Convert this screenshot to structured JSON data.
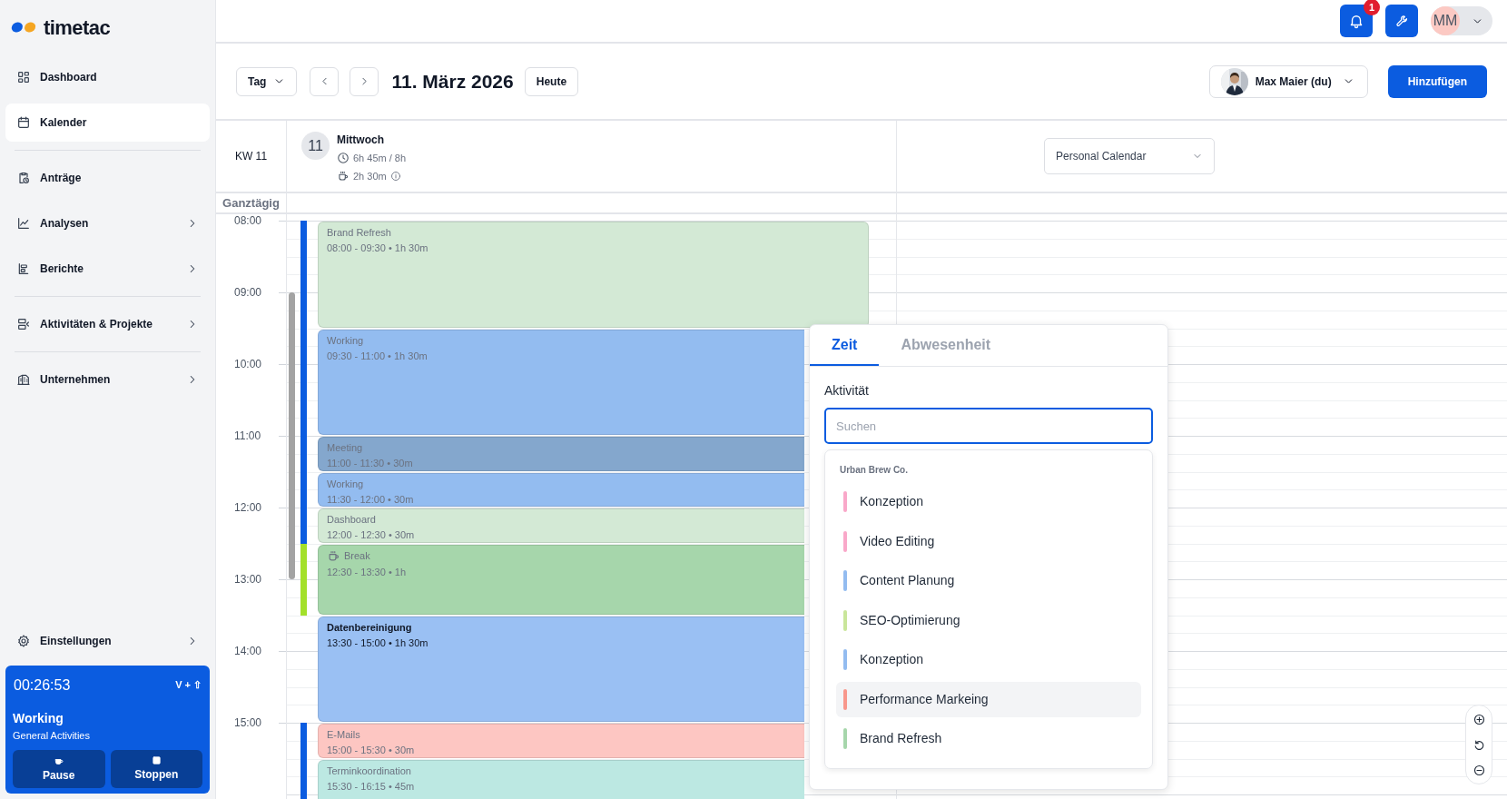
{
  "sidebar": {
    "logo": "timetac",
    "sections": [
      [
        {
          "label": "Dashboard",
          "selected": false,
          "submenu": false
        },
        {
          "label": "Kalender",
          "selected": true,
          "submenu": false
        }
      ],
      [
        {
          "label": "Anträge",
          "selected": false,
          "submenu": false
        },
        {
          "label": "Analysen",
          "selected": false,
          "submenu": true
        },
        {
          "label": "Berichte",
          "selected": false,
          "submenu": true
        }
      ],
      [
        {
          "label": "Aktivitäten & Projekte",
          "selected": false,
          "submenu": true
        }
      ],
      [
        {
          "label": "Unternehmen",
          "selected": false,
          "submenu": true
        }
      ]
    ],
    "footer_item": {
      "label": "Einstellungen",
      "submenu": true
    },
    "timer": {
      "time": "00:26:53",
      "shortcut": "V + ⇧",
      "activity": "Working",
      "category": "General Activities",
      "buttons": [
        "Pause",
        "Stoppen"
      ]
    }
  },
  "topbar": {
    "notifications": "1",
    "user_initials": "MM"
  },
  "toolbar": {
    "view": "Tag",
    "date": "11. März 2026",
    "today": "Heute",
    "user": "Max Maier (du)",
    "add": "Hinzufügen"
  },
  "day_header": {
    "week": "KW 11",
    "day_number": "11",
    "weekday": "Mittwoch",
    "worked": "6h 45m / 8h",
    "break": "2h 30m",
    "calendar": "Personal Calendar"
  },
  "all_day_label": "Ganztägig",
  "hours": [
    "08:00",
    "09:00",
    "10:00",
    "11:00",
    "12:00",
    "13:00",
    "14:00",
    "15:00"
  ],
  "events": [
    {
      "title": "Brand Refresh",
      "time": "08:00 - 09:30 • 1h 30m",
      "color": "#d3e9d5",
      "kind": "work",
      "tracking": {
        "color": "#0b5ce0"
      },
      "selected": false
    },
    {
      "title": "Working",
      "time": "09:30 - 11:00 • 1h 30m",
      "color": "#93bcf0",
      "kind": "work",
      "tracking": {
        "color": "#0b5ce0"
      },
      "selected": false
    },
    {
      "title": "Meeting",
      "time": "11:00 - 11:30 • 30m",
      "color": "#84a7cd",
      "kind": "work",
      "tracking": {
        "color": "#0b5ce0"
      },
      "selected": false
    },
    {
      "title": "Working",
      "time": "11:30 - 12:00 • 30m",
      "color": "#93bcf0",
      "kind": "work",
      "tracking": {
        "color": "#0b5ce0"
      },
      "selected": false
    },
    {
      "title": "Dashboard",
      "time": "12:00 - 12:30 • 30m",
      "color": "#d3e9d5",
      "kind": "work",
      "tracking": {
        "color": "#0b5ce0"
      },
      "selected": false
    },
    {
      "title": "Break",
      "time": "12:30 - 13:30 • 1h",
      "color": "#a6d6ab",
      "kind": "break",
      "tracking": {
        "color": "#a3e02a"
      },
      "selected": false
    },
    {
      "title": "Datenbereinigung",
      "time": "13:30 - 15:00 • 1h 30m",
      "color": "#9ac0f3",
      "kind": "work",
      "selected": true
    },
    {
      "title": "E-Mails",
      "time": "15:00 - 15:30 • 30m",
      "color": "#fdc6c2",
      "kind": "work",
      "tracking": {
        "color": "#0b5ce0"
      },
      "selected": false
    },
    {
      "title": "Terminkoordination",
      "time": "15:30 - 16:15 • 45m",
      "color": "#bce8e2",
      "kind": "work",
      "tracking": {
        "color": "#0b5ce0"
      },
      "selected": false
    }
  ],
  "popup": {
    "tabs": [
      {
        "label": "Zeit",
        "selected": true
      },
      {
        "label": "Abwesenheit",
        "selected": false
      }
    ],
    "field_label": "Aktivität",
    "search": {
      "placeholder": "Suchen"
    },
    "group": "Urban Brew Co.",
    "items": [
      {
        "label": "Konzeption",
        "color": "#f9a8c9",
        "selected": false
      },
      {
        "label": "Video Editing",
        "color": "#f9a8c9",
        "selected": false
      },
      {
        "label": "Content Planung",
        "color": "#93bcf0",
        "selected": false
      },
      {
        "label": "SEO-Optimierung",
        "color": "#c9e69b",
        "selected": false
      },
      {
        "label": "Konzeption",
        "color": "#93bcf0",
        "selected": false
      },
      {
        "label": "Performance Markeing",
        "color": "#f8978c",
        "selected": true
      },
      {
        "label": "Brand Refresh",
        "color": "#a6d6ab",
        "selected": false
      }
    ]
  }
}
